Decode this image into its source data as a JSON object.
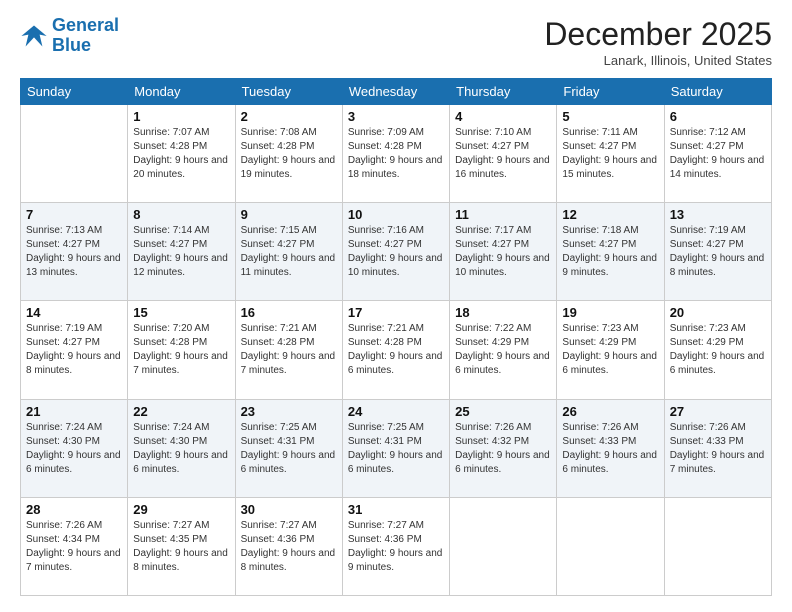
{
  "logo": {
    "line1": "General",
    "line2": "Blue"
  },
  "header": {
    "month": "December 2025",
    "location": "Lanark, Illinois, United States"
  },
  "weekdays": [
    "Sunday",
    "Monday",
    "Tuesday",
    "Wednesday",
    "Thursday",
    "Friday",
    "Saturday"
  ],
  "weeks": [
    [
      {
        "day": "",
        "sunrise": "",
        "sunset": "",
        "daylight": ""
      },
      {
        "day": "1",
        "sunrise": "Sunrise: 7:07 AM",
        "sunset": "Sunset: 4:28 PM",
        "daylight": "Daylight: 9 hours and 20 minutes."
      },
      {
        "day": "2",
        "sunrise": "Sunrise: 7:08 AM",
        "sunset": "Sunset: 4:28 PM",
        "daylight": "Daylight: 9 hours and 19 minutes."
      },
      {
        "day": "3",
        "sunrise": "Sunrise: 7:09 AM",
        "sunset": "Sunset: 4:28 PM",
        "daylight": "Daylight: 9 hours and 18 minutes."
      },
      {
        "day": "4",
        "sunrise": "Sunrise: 7:10 AM",
        "sunset": "Sunset: 4:27 PM",
        "daylight": "Daylight: 9 hours and 16 minutes."
      },
      {
        "day": "5",
        "sunrise": "Sunrise: 7:11 AM",
        "sunset": "Sunset: 4:27 PM",
        "daylight": "Daylight: 9 hours and 15 minutes."
      },
      {
        "day": "6",
        "sunrise": "Sunrise: 7:12 AM",
        "sunset": "Sunset: 4:27 PM",
        "daylight": "Daylight: 9 hours and 14 minutes."
      }
    ],
    [
      {
        "day": "7",
        "sunrise": "Sunrise: 7:13 AM",
        "sunset": "Sunset: 4:27 PM",
        "daylight": "Daylight: 9 hours and 13 minutes."
      },
      {
        "day": "8",
        "sunrise": "Sunrise: 7:14 AM",
        "sunset": "Sunset: 4:27 PM",
        "daylight": "Daylight: 9 hours and 12 minutes."
      },
      {
        "day": "9",
        "sunrise": "Sunrise: 7:15 AM",
        "sunset": "Sunset: 4:27 PM",
        "daylight": "Daylight: 9 hours and 11 minutes."
      },
      {
        "day": "10",
        "sunrise": "Sunrise: 7:16 AM",
        "sunset": "Sunset: 4:27 PM",
        "daylight": "Daylight: 9 hours and 10 minutes."
      },
      {
        "day": "11",
        "sunrise": "Sunrise: 7:17 AM",
        "sunset": "Sunset: 4:27 PM",
        "daylight": "Daylight: 9 hours and 10 minutes."
      },
      {
        "day": "12",
        "sunrise": "Sunrise: 7:18 AM",
        "sunset": "Sunset: 4:27 PM",
        "daylight": "Daylight: 9 hours and 9 minutes."
      },
      {
        "day": "13",
        "sunrise": "Sunrise: 7:19 AM",
        "sunset": "Sunset: 4:27 PM",
        "daylight": "Daylight: 9 hours and 8 minutes."
      }
    ],
    [
      {
        "day": "14",
        "sunrise": "Sunrise: 7:19 AM",
        "sunset": "Sunset: 4:27 PM",
        "daylight": "Daylight: 9 hours and 8 minutes."
      },
      {
        "day": "15",
        "sunrise": "Sunrise: 7:20 AM",
        "sunset": "Sunset: 4:28 PM",
        "daylight": "Daylight: 9 hours and 7 minutes."
      },
      {
        "day": "16",
        "sunrise": "Sunrise: 7:21 AM",
        "sunset": "Sunset: 4:28 PM",
        "daylight": "Daylight: 9 hours and 7 minutes."
      },
      {
        "day": "17",
        "sunrise": "Sunrise: 7:21 AM",
        "sunset": "Sunset: 4:28 PM",
        "daylight": "Daylight: 9 hours and 6 minutes."
      },
      {
        "day": "18",
        "sunrise": "Sunrise: 7:22 AM",
        "sunset": "Sunset: 4:29 PM",
        "daylight": "Daylight: 9 hours and 6 minutes."
      },
      {
        "day": "19",
        "sunrise": "Sunrise: 7:23 AM",
        "sunset": "Sunset: 4:29 PM",
        "daylight": "Daylight: 9 hours and 6 minutes."
      },
      {
        "day": "20",
        "sunrise": "Sunrise: 7:23 AM",
        "sunset": "Sunset: 4:29 PM",
        "daylight": "Daylight: 9 hours and 6 minutes."
      }
    ],
    [
      {
        "day": "21",
        "sunrise": "Sunrise: 7:24 AM",
        "sunset": "Sunset: 4:30 PM",
        "daylight": "Daylight: 9 hours and 6 minutes."
      },
      {
        "day": "22",
        "sunrise": "Sunrise: 7:24 AM",
        "sunset": "Sunset: 4:30 PM",
        "daylight": "Daylight: 9 hours and 6 minutes."
      },
      {
        "day": "23",
        "sunrise": "Sunrise: 7:25 AM",
        "sunset": "Sunset: 4:31 PM",
        "daylight": "Daylight: 9 hours and 6 minutes."
      },
      {
        "day": "24",
        "sunrise": "Sunrise: 7:25 AM",
        "sunset": "Sunset: 4:31 PM",
        "daylight": "Daylight: 9 hours and 6 minutes."
      },
      {
        "day": "25",
        "sunrise": "Sunrise: 7:26 AM",
        "sunset": "Sunset: 4:32 PM",
        "daylight": "Daylight: 9 hours and 6 minutes."
      },
      {
        "day": "26",
        "sunrise": "Sunrise: 7:26 AM",
        "sunset": "Sunset: 4:33 PM",
        "daylight": "Daylight: 9 hours and 6 minutes."
      },
      {
        "day": "27",
        "sunrise": "Sunrise: 7:26 AM",
        "sunset": "Sunset: 4:33 PM",
        "daylight": "Daylight: 9 hours and 7 minutes."
      }
    ],
    [
      {
        "day": "28",
        "sunrise": "Sunrise: 7:26 AM",
        "sunset": "Sunset: 4:34 PM",
        "daylight": "Daylight: 9 hours and 7 minutes."
      },
      {
        "day": "29",
        "sunrise": "Sunrise: 7:27 AM",
        "sunset": "Sunset: 4:35 PM",
        "daylight": "Daylight: 9 hours and 8 minutes."
      },
      {
        "day": "30",
        "sunrise": "Sunrise: 7:27 AM",
        "sunset": "Sunset: 4:36 PM",
        "daylight": "Daylight: 9 hours and 8 minutes."
      },
      {
        "day": "31",
        "sunrise": "Sunrise: 7:27 AM",
        "sunset": "Sunset: 4:36 PM",
        "daylight": "Daylight: 9 hours and 9 minutes."
      },
      {
        "day": "",
        "sunrise": "",
        "sunset": "",
        "daylight": ""
      },
      {
        "day": "",
        "sunrise": "",
        "sunset": "",
        "daylight": ""
      },
      {
        "day": "",
        "sunrise": "",
        "sunset": "",
        "daylight": ""
      }
    ]
  ]
}
